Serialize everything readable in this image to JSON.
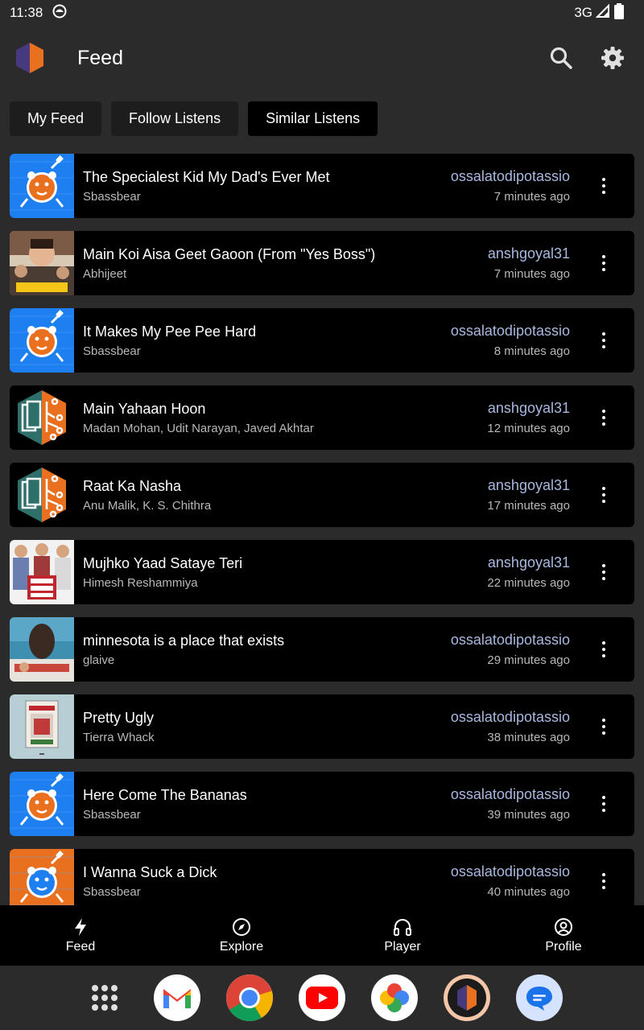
{
  "status": {
    "time": "11:38",
    "network": "3G"
  },
  "app": {
    "title": "Feed"
  },
  "tabs": [
    {
      "label": "My Feed",
      "active": false
    },
    {
      "label": "Follow Listens",
      "active": false
    },
    {
      "label": "Similar Listens",
      "active": true
    }
  ],
  "feed": [
    {
      "title": "The Specialest Kid My Dad's Ever Met",
      "artist": "Sbassbear",
      "user": "ossalatodipotassio",
      "time": "7 minutes ago",
      "art": "bear-blue"
    },
    {
      "title": "Main Koi Aisa Geet Gaoon (From \"Yes Boss\")",
      "artist": "Abhijeet",
      "user": "anshgoyal31",
      "time": "7 minutes ago",
      "art": "photo-yesboss"
    },
    {
      "title": "It Makes My Pee Pee Hard",
      "artist": "Sbassbear",
      "user": "ossalatodipotassio",
      "time": "8 minutes ago",
      "art": "bear-blue"
    },
    {
      "title": "Main Yahaan Hoon",
      "artist": "Madan Mohan, Udit Narayan, Javed Akhtar",
      "user": "anshgoyal31",
      "time": "12 minutes ago",
      "art": "hexagon-logo"
    },
    {
      "title": "Raat Ka Nasha",
      "artist": "Anu Malik, K. S. Chithra",
      "user": "anshgoyal31",
      "time": "17 minutes ago",
      "art": "hexagon-logo"
    },
    {
      "title": "Mujhko Yaad Sataye Teri",
      "artist": "Himesh Reshammiya",
      "user": "anshgoyal31",
      "time": "22 minutes ago",
      "art": "photo-phirheraphen"
    },
    {
      "title": "minnesota is a place that exists",
      "artist": "glaive",
      "user": "ossalatodipotassio",
      "time": "29 minutes ago",
      "art": "photo-minnesota"
    },
    {
      "title": "Pretty Ugly",
      "artist": "Tierra Whack",
      "user": "ossalatodipotassio",
      "time": "38 minutes ago",
      "art": "photo-prettyugly"
    },
    {
      "title": "Here Come The Bananas",
      "artist": "Sbassbear",
      "user": "ossalatodipotassio",
      "time": "39 minutes ago",
      "art": "bear-blue"
    },
    {
      "title": "I Wanna Suck a Dick",
      "artist": "Sbassbear",
      "user": "ossalatodipotassio",
      "time": "40 minutes ago",
      "art": "bear-orange"
    }
  ],
  "bottom_nav": [
    {
      "label": "Feed",
      "icon": "bolt-icon"
    },
    {
      "label": "Explore",
      "icon": "compass-icon"
    },
    {
      "label": "Player",
      "icon": "headphones-icon"
    },
    {
      "label": "Profile",
      "icon": "profile-icon"
    }
  ],
  "dock": [
    "app-drawer-icon",
    "gmail-icon",
    "chrome-icon",
    "youtube-icon",
    "photos-icon",
    "listenbrainz-icon",
    "messages-icon"
  ],
  "colors": {
    "accent_user": "#a9b8df",
    "card_bg": "#000000",
    "app_bg": "#2b2b2b",
    "art_blue": "#1e7ff0",
    "art_orange": "#e8701f"
  }
}
